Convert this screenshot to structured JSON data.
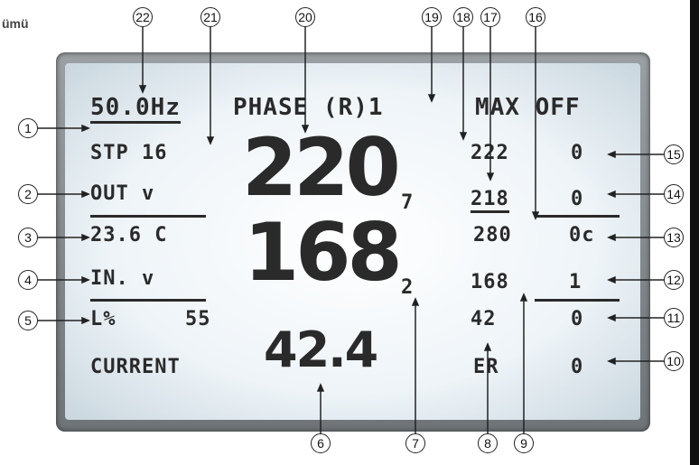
{
  "caption": "ümü",
  "display": {
    "frequency": "50.0Hz",
    "phase": "PHASE (R)1",
    "max": "MAX OFF",
    "step": "STP 16",
    "out_label": "OUT v",
    "temp": "23.6 C",
    "in_label": "IN. v",
    "lx_label": "L%",
    "lx_value": "55",
    "current_label": "CURRENT",
    "out_value": "220",
    "out_suffix": "7",
    "in_value": "168",
    "in_suffix": "2",
    "current_value": "42.4",
    "r_out_max": "222",
    "r_out_max_n": "0",
    "r_out_min": "218",
    "r_out_min_n": "0",
    "r_temp": "280",
    "r_temp_n": "0c",
    "r_in": "168",
    "r_in_n": "1",
    "r_current": "42",
    "r_current_n": "0",
    "r_err": "ER",
    "r_err_n": "0"
  },
  "callouts": [
    "1",
    "2",
    "3",
    "4",
    "5",
    "6",
    "7",
    "8",
    "9",
    "10",
    "11",
    "12",
    "13",
    "14",
    "15",
    "16",
    "17",
    "18",
    "19",
    "20",
    "21",
    "22"
  ]
}
